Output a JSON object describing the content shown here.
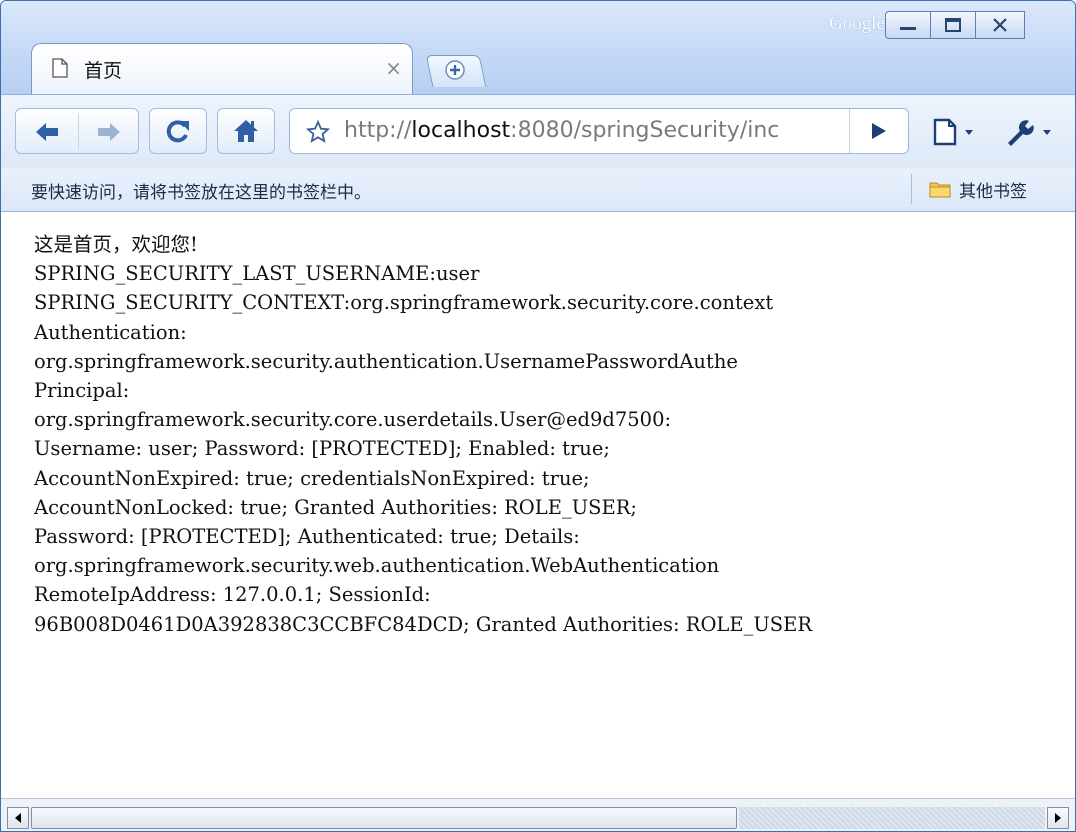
{
  "window": {
    "brand": "Google",
    "controls": {
      "minimize": "minimize",
      "maximize": "maximize",
      "close": "close"
    }
  },
  "tab": {
    "title": "首页",
    "close": "×",
    "icon": "page-icon"
  },
  "toolbar": {
    "url_prefix": "http://",
    "url_host": "localhost",
    "url_rest": ":8080/springSecurity/inc"
  },
  "bookmarks_bar": {
    "hint": "要快速访问，请将书签放在这里的书签栏中。",
    "other_bookmarks": "其他书签"
  },
  "content": {
    "lines": [
      "这是首页，欢迎您!",
      "SPRING_SECURITY_LAST_USERNAME:user",
      "SPRING_SECURITY_CONTEXT:org.springframework.security.core.context",
      "Authentication:",
      "org.springframework.security.authentication.UsernamePasswordAuthe",
      "Principal:",
      "org.springframework.security.core.userdetails.User@ed9d7500:",
      "Username: user; Password: [PROTECTED]; Enabled: true;",
      "AccountNonExpired: true; credentialsNonExpired: true;",
      "AccountNonLocked: true; Granted Authorities: ROLE_USER;",
      "Password: [PROTECTED]; Authenticated: true; Details:",
      "org.springframework.security.web.authentication.WebAuthentication",
      "RemoteIpAddress: 127.0.0.1; SessionId:",
      "96B008D0461D0A392838C3CCBFC84DCD; Granted Authorities: ROLE_USER"
    ]
  },
  "scrollbar": {
    "position": 0.0,
    "visible_fraction": 0.66
  },
  "colors": {
    "frame": "#3d6fb0",
    "toolbar": "#dde8f8",
    "brand": "#ffffff"
  }
}
